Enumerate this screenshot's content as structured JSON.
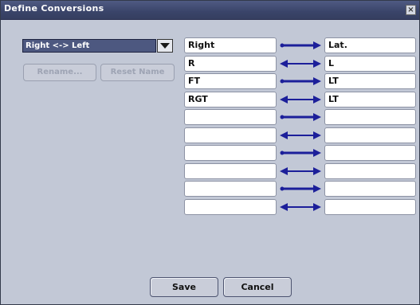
{
  "dialog": {
    "title": "Define Conversions",
    "close_glyph": "×"
  },
  "selector": {
    "value": "Right <-> Left",
    "options_icon": "chevron-down-icon"
  },
  "buttons": {
    "rename": "Rename...",
    "reset_name": "Reset Name",
    "save": "Save",
    "cancel": "Cancel"
  },
  "pairs": [
    {
      "left": "Right",
      "right": "Lat.",
      "arrow": "single"
    },
    {
      "left": "R",
      "right": "L",
      "arrow": "double"
    },
    {
      "left": "FT",
      "right": "LT",
      "arrow": "single"
    },
    {
      "left": "RGT",
      "right": "LT",
      "arrow": "double"
    },
    {
      "left": "",
      "right": "",
      "arrow": "single"
    },
    {
      "left": "",
      "right": "",
      "arrow": "double"
    },
    {
      "left": "",
      "right": "",
      "arrow": "single"
    },
    {
      "left": "",
      "right": "",
      "arrow": "double"
    },
    {
      "left": "",
      "right": "",
      "arrow": "single"
    },
    {
      "left": "",
      "right": "",
      "arrow": "double"
    }
  ],
  "colors": {
    "arrow": "#1c1f9a",
    "title_bar": "#3a4469",
    "background": "#c2c8d6"
  }
}
